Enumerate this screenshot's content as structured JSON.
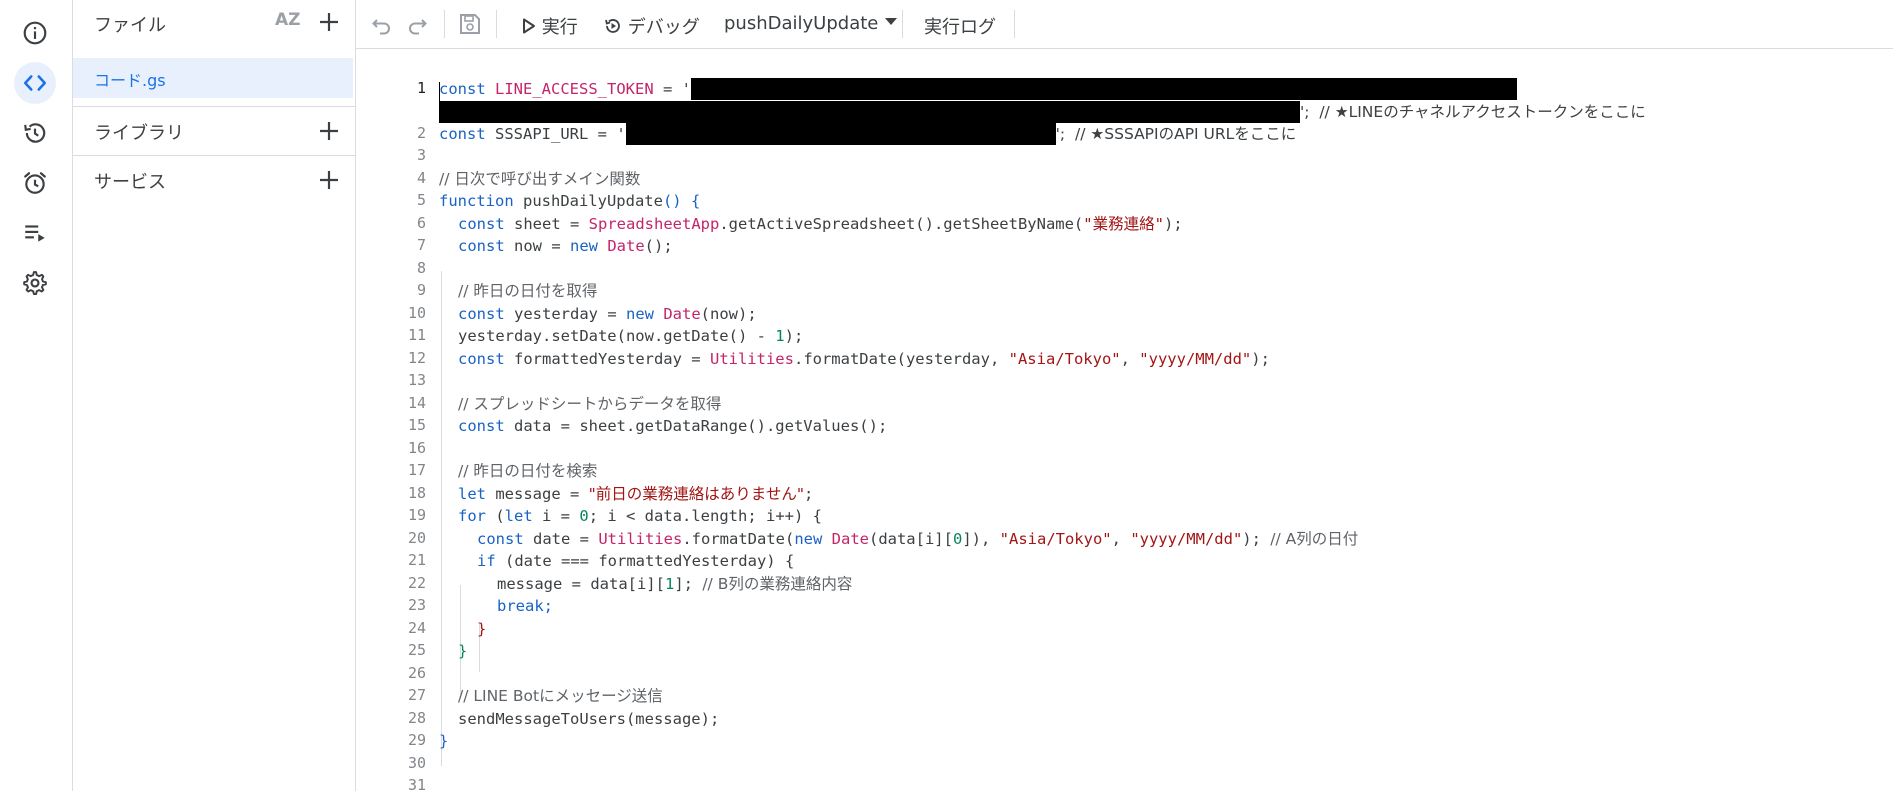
{
  "sidebar_rail": {
    "items": [
      {
        "icon": "info-icon"
      },
      {
        "icon": "code-icon",
        "active": true
      },
      {
        "icon": "history-icon"
      },
      {
        "icon": "alarm-icon"
      },
      {
        "icon": "executions-icon"
      },
      {
        "icon": "settings-icon"
      }
    ]
  },
  "files_panel": {
    "title": "ファイル",
    "sort_label": "AZ",
    "files": [
      "コード.gs"
    ],
    "libraries_label": "ライブラリ",
    "services_label": "サービス"
  },
  "toolbar": {
    "run_label": "実行",
    "debug_label": "デバッグ",
    "function_select": "pushDailyUpdate",
    "log_label": "実行ログ"
  },
  "editor": {
    "line_numbers": [
      "1",
      "2",
      "3",
      "4",
      "5",
      "6",
      "7",
      "8",
      "9",
      "10",
      "11",
      "12",
      "13",
      "14",
      "15",
      "16",
      "17",
      "18",
      "19",
      "20",
      "21",
      "22",
      "23",
      "24",
      "25",
      "26",
      "27",
      "28",
      "29",
      "30",
      "31"
    ],
    "lines": {
      "l1a": "const",
      "l1b": "LINE_ACCESS_TOKEN",
      "l1c": " = '",
      "l1d": "';  // ★LINEのチャネルアクセストークンをここに",
      "l2a": "const",
      "l2b": " SSSAPI_URL = '",
      "l2c": "';  // ★SSSAPIのAPI URLをここに",
      "l4": "// 日次で呼び出すメイン関数",
      "l5a": "function",
      "l5b": " pushDailyUpdate",
      "l5c": "() {",
      "l6a": "const",
      "l6b": " sheet = ",
      "l6c": "SpreadsheetApp",
      "l6d": ".getActiveSpreadsheet().getSheetByName(",
      "l6e": "\"業務連絡\"",
      "l6f": ");",
      "l7a": "const",
      "l7b": " now = ",
      "l7c": "new",
      "l7d": "Date",
      "l7e": "();",
      "l9": "// 昨日の日付を取得",
      "l10a": "const",
      "l10b": " yesterday = ",
      "l10c": "new",
      "l10d": "Date",
      "l10e": "(now);",
      "l11a": "yesterday.setDate(now.getDate() - ",
      "l11b": "1",
      "l11c": ");",
      "l12a": "const",
      "l12b": " formattedYesterday = ",
      "l12c": "Utilities",
      "l12d": ".formatDate(yesterday, ",
      "l12e": "\"Asia/Tokyo\"",
      "l12f": ", ",
      "l12g": "\"yyyy/MM/dd\"",
      "l12h": ");",
      "l14": "// スプレッドシートからデータを取得",
      "l15a": "const",
      "l15b": " data = sheet.getDataRange().getValues();",
      "l17": "// 昨日の日付を検索",
      "l18a": "let",
      "l18b": " message = ",
      "l18c": "\"前日の業務連絡はありません\"",
      "l18d": ";",
      "l19a": "for",
      "l19b": " (",
      "l19c": "let",
      "l19d": " i = ",
      "l19e": "0",
      "l19f": "; i < data.length; i++) {",
      "l20a": "const",
      "l20b": " date = ",
      "l20c": "Utilities",
      "l20d": ".formatDate(",
      "l20e": "new",
      "l20f": "Date",
      "l20g": "(data[i][",
      "l20h": "0",
      "l20i": "]), ",
      "l20j": "\"Asia/Tokyo\"",
      "l20k": ", ",
      "l20l": "\"yyyy/MM/dd\"",
      "l20m": "); ",
      "l20n": "// A列の日付",
      "l21a": "if",
      "l21b": " (date === formattedYesterday) {",
      "l22a": "message = data[i][",
      "l22b": "1",
      "l22c": "]; ",
      "l22d": "// B列の業務連絡内容",
      "l23": "break;",
      "l24": "}",
      "l25": "}",
      "l27": "// LINE Botにメッセージ送信",
      "l28": "sendMessageToUsers(message);",
      "l29": "}"
    }
  },
  "colors": {
    "accent": "#1a73e8",
    "active_bg": "#e8f0fe",
    "keyword": "#1a62c6",
    "type": "#c5246b",
    "string": "#a31515",
    "comment": "#5f6368",
    "redaction": "#000000"
  }
}
